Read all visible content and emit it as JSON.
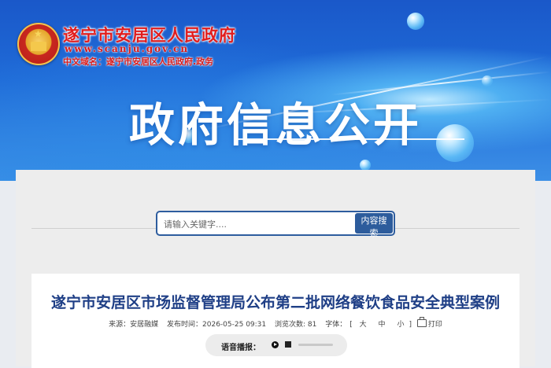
{
  "header": {
    "site_name": "遂宁市安居区人民政府",
    "domain": "www.scanju.gov.cn",
    "cn_domain": "中文域名：遂宁市安居区人民政府.政务",
    "banner_title": "政府信息公开"
  },
  "search": {
    "placeholder": "请输入关键字....",
    "button_label": "内容搜索"
  },
  "article": {
    "title": "遂宁市安居区市场监督管理局公布第二批网络餐饮食品安全典型案例",
    "source": "来源：安居融媒",
    "published": "发布时间：2026-05-25 09:31",
    "views": "浏览次数: 81",
    "font_size_label": "字体：",
    "font_size_open": "[",
    "font_large": "大",
    "font_medium": "中",
    "font_small": "小",
    "font_size_close": "]",
    "print_label": "打印"
  },
  "audio": {
    "label": "语音播报：",
    "progress": 0
  },
  "colors": {
    "banner": "#1f6bd8",
    "site_name_red": "#e11d1d",
    "title_blue": "#1f3f86",
    "search_button": "#2d5c9c"
  }
}
